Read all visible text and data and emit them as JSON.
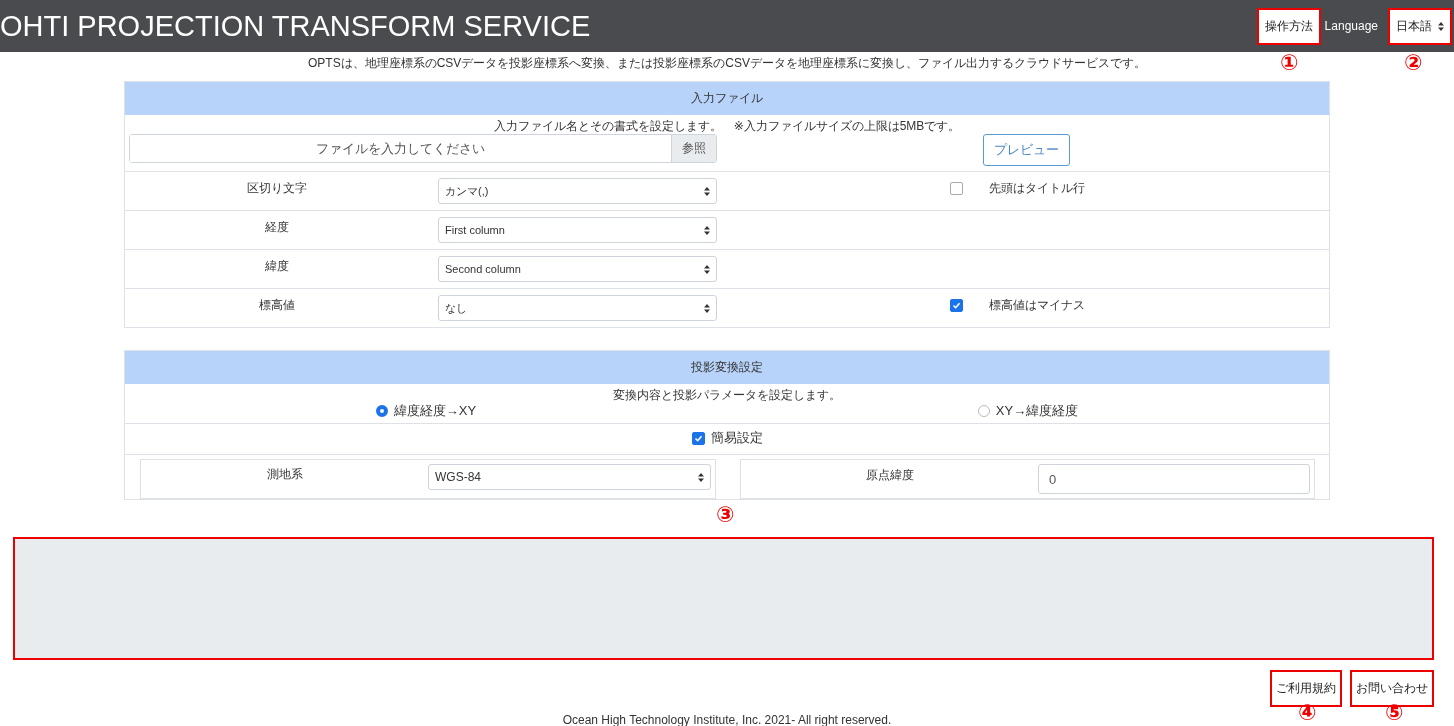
{
  "header": {
    "title": "OHTI PROJECTION TRANSFORM SERVICE",
    "help_button": "操作方法",
    "language_label": "Language",
    "language_select": "日本語"
  },
  "intro": "OPTSは、地理座標系のCSVデータを投影座標系へ変換、または投影座標系のCSVデータを地理座標系に変換し、ファイル出力するクラウドサービスです。",
  "input_file": {
    "title": "入力ファイル",
    "description": "入力ファイル名とその書式を設定します。　※入力ファイルサイズの上限は5MBです。",
    "file_placeholder": "ファイルを入力してください",
    "browse_button": "参照",
    "preview_button": "プレビュー",
    "rows": [
      {
        "label": "区切り文字",
        "value": "カンマ(,)",
        "option": {
          "label": "先頭はタイトル行",
          "checked": false
        }
      },
      {
        "label": "経度",
        "value": "First column"
      },
      {
        "label": "緯度",
        "value": "Second column"
      },
      {
        "label": "標高値",
        "value": "なし",
        "option": {
          "label": "標高値はマイナス",
          "checked": true
        }
      }
    ]
  },
  "projection": {
    "title": "投影変換設定",
    "description": "変換内容と投影パラメータを設定します。",
    "modes": [
      {
        "label": "緯度経度→XY",
        "selected": true
      },
      {
        "label": "XY→緯度経度",
        "selected": false
      }
    ],
    "simple": {
      "label": "簡易設定",
      "checked": true
    },
    "left_params": [
      {
        "label": "測地系",
        "kind": "select",
        "value": "WGS-84"
      }
    ],
    "right_params": [
      {
        "label": "原点緯度",
        "kind": "input",
        "value": "0"
      }
    ]
  },
  "footer": {
    "links": [
      "ご利用規約",
      "お問い合わせ"
    ],
    "copyright": "Ocean High Technology Institute, Inc. 2021- All right reserved."
  },
  "callouts": [
    "①",
    "②",
    "③",
    "④",
    "⑤"
  ]
}
